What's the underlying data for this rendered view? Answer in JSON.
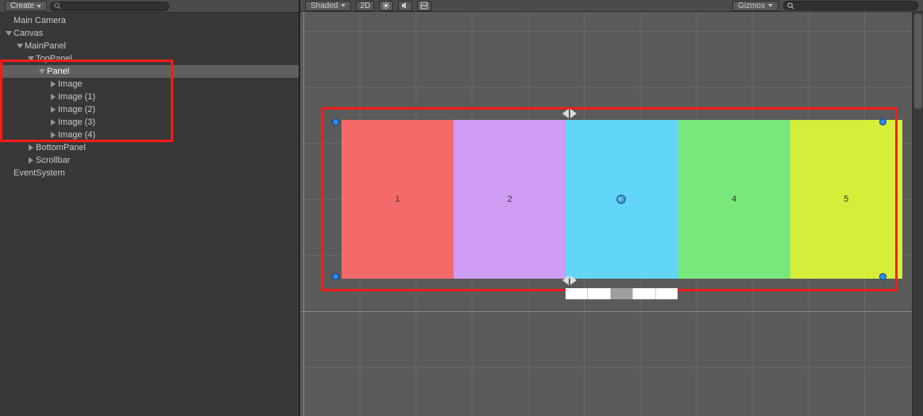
{
  "toolbar": {
    "create_label": "Create",
    "shaded_label": "Shaded",
    "mode2d": "2D",
    "gizmos_label": "Gizmos"
  },
  "hierarchy": [
    {
      "label": "Main Camera",
      "indent": 0,
      "fold": "none",
      "selected": false
    },
    {
      "label": "Canvas",
      "indent": 0,
      "fold": "down",
      "selected": false
    },
    {
      "label": "MainPanel",
      "indent": 1,
      "fold": "down",
      "selected": false
    },
    {
      "label": "TopPanel",
      "indent": 2,
      "fold": "down",
      "selected": false
    },
    {
      "label": "Panel",
      "indent": 3,
      "fold": "down",
      "selected": true
    },
    {
      "label": "Image",
      "indent": 4,
      "fold": "right",
      "selected": false
    },
    {
      "label": "Image (1)",
      "indent": 4,
      "fold": "right",
      "selected": false
    },
    {
      "label": "Image (2)",
      "indent": 4,
      "fold": "right",
      "selected": false
    },
    {
      "label": "Image (3)",
      "indent": 4,
      "fold": "right",
      "selected": false
    },
    {
      "label": "Image (4)",
      "indent": 4,
      "fold": "right",
      "selected": false
    },
    {
      "label": "BottomPanel",
      "indent": 2,
      "fold": "right",
      "selected": false
    },
    {
      "label": "Scrollbar",
      "indent": 2,
      "fold": "right",
      "selected": false
    },
    {
      "label": "EventSystem",
      "indent": 0,
      "fold": "none",
      "selected": false
    }
  ],
  "panels": [
    {
      "num": "1",
      "color": "#f46a6a"
    },
    {
      "num": "2",
      "color": "#cf9cf4"
    },
    {
      "num": "3",
      "color": "#62d6f7"
    },
    {
      "num": "4",
      "color": "#79e87c"
    },
    {
      "num": "5",
      "color": "#d6ee3a"
    }
  ]
}
